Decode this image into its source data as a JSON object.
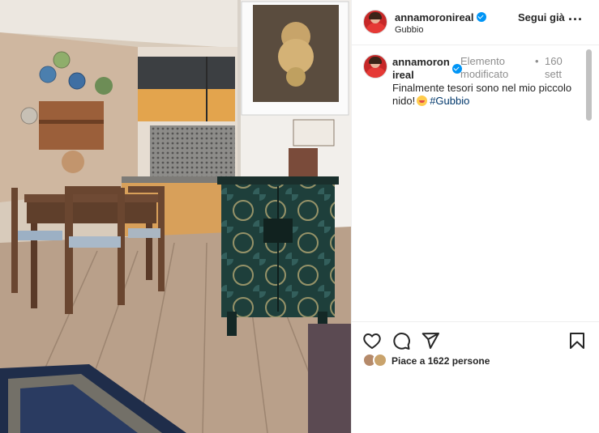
{
  "post": {
    "image_description_icon": "photo-icon"
  },
  "header": {
    "username": "annamoronireal",
    "location": "Gubbio",
    "follow_label": "Segui già",
    "more_label": "...",
    "verified_icon": "verified-badge-icon",
    "more_icon": "more-options-icon"
  },
  "caption": {
    "username_line1": "annamoron",
    "username_line2": "ireal",
    "edited_label": "Elemento modificato",
    "separator": "•",
    "time": "160 sett",
    "text": "Finalmente tesori sono nel mio piccolo nido!",
    "emoji_icon": "smiling-face-with-hearts-icon",
    "hashtag": "#Gubbio"
  },
  "actions": {
    "like_icon": "heart-icon",
    "comment_icon": "comment-icon",
    "share_icon": "send-icon",
    "save_icon": "bookmark-icon"
  },
  "likes": {
    "text": "Piace a 1622 persone"
  },
  "colors": {
    "link": "#00376b",
    "verified": "#0095f6",
    "muted": "#8e8e8e"
  }
}
